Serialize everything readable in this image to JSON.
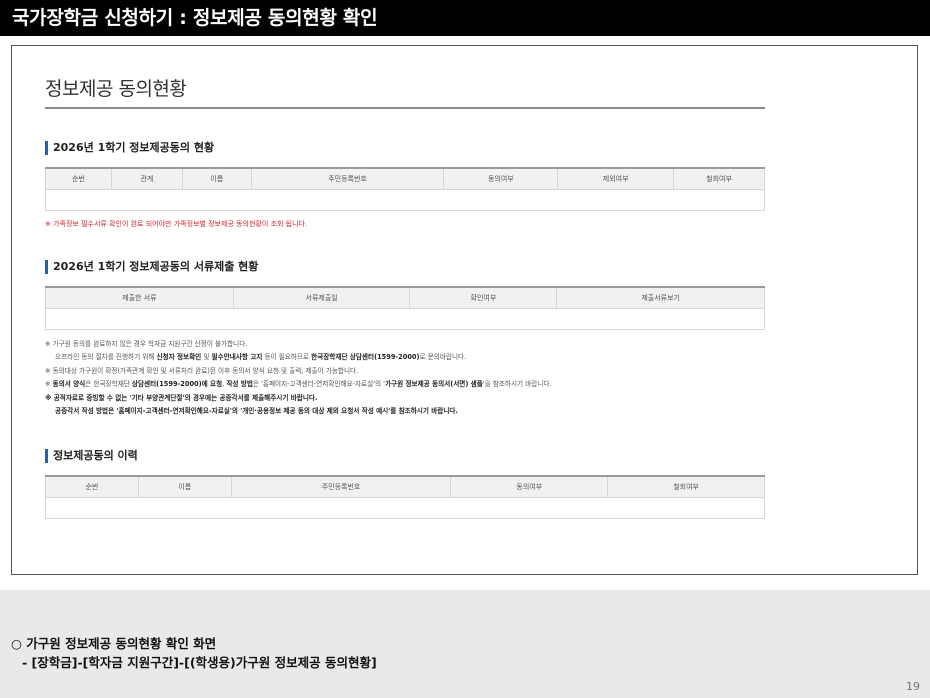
{
  "slide": {
    "title": "국가장학금 신청하기 : 정보제공 동의현황 확인",
    "caption_line1": "○ 가구원 정보제공 동의현황 확인 화면",
    "caption_line2": "- [장학금]-[학자금 지원구간]-[(학생용)가구원 정보제공 동의현황]",
    "page_number": "19"
  },
  "screen": {
    "page_title": "정보제공 동의현황",
    "section1": {
      "heading": "2026년 1학기 정보제공동의 현황",
      "columns": [
        "순번",
        "관계",
        "이름",
        "주민등록번호",
        "동의여부",
        "제외여부",
        "철회여부"
      ],
      "note": "※ 가족정보 필수서류 확인이 완료 되어야만 가족정보별 정보제공 동의현황이 조회 됩니다."
    },
    "section2": {
      "heading": "2026년 1학기 정보제공동의 서류제출 현황",
      "columns": [
        "제출한 서류",
        "서류제출일",
        "확인여부",
        "제출서류보기"
      ]
    },
    "notes": {
      "n1": "※ 가구원 동의를 완료하지 않은 경우 학자금 지원구간 산정이 불가합니다.",
      "n1b_pre": "오프라인 동의 절차를 진행하기 위해 ",
      "n1b_b1": "신청자 정보확인",
      "n1b_mid1": " 및 ",
      "n1b_b2": "필수안내사항 고지",
      "n1b_mid2": " 등이 필요하므로 ",
      "n1b_b3": "한국장학재단 상담센터(1599-2000)",
      "n1b_post": "로 문의바랍니다.",
      "n2": "※ 동의대상 가구원이 확정(가족관계 확인 및 서류처리 완료)된 이후 동의서 양식 요청 및 출력, 제출이 가능합니다.",
      "n3_pre": "※ ",
      "n3_b1": "동의서 양식",
      "n3_mid1": "은 한국장학재단 ",
      "n3_b2": "상담센터(1599-2000)에 요청",
      "n3_mid2": ", ",
      "n3_b3": "작성 방법",
      "n3_mid3": "은 '홈페이지-고객센터-연저확인해요-자료실'의 '",
      "n3_b4": "가구원 정보제공 동의서(서면) 샘플",
      "n3_post": "'을 참조하시기 바랍니다.",
      "n4": "※ 공적자료로 증빙할 수 없는 '기타 부양관계단절'의 경우에는 공증각서를 제출해주시기 바랍니다.",
      "n4b": "공증각서 작성 방법은 '홈페이지-고객센터-연저확인해요-자료실'의 '개인·공용정보 제공 동의 대상 제외 요청서 작성 예시'를 참조하시기 바랍니다."
    },
    "section3": {
      "heading": "정보제공동의 이력",
      "columns": [
        "순번",
        "이름",
        "주민등록번호",
        "동의여부",
        "철회여부"
      ]
    }
  }
}
